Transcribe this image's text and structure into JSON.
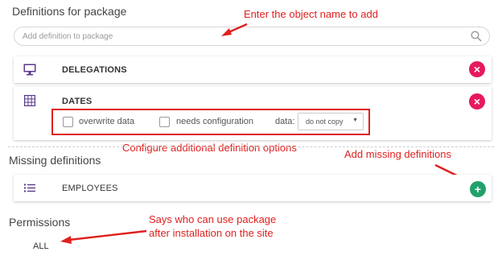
{
  "definitions": {
    "title": "Definitions for package",
    "search_placeholder": "Add definition to package",
    "items": [
      {
        "icon": "monitor-icon",
        "label": "DELEGATIONS"
      },
      {
        "icon": "grid-icon",
        "label": "DATES"
      }
    ],
    "options": {
      "overwrite_label": "overwrite data",
      "needs_config_label": "needs configuration",
      "data_label": "data:",
      "data_value": "do not copy",
      "overwrite_checked": false,
      "needs_config_checked": false
    }
  },
  "missing": {
    "title": "Missing definitions",
    "items": [
      {
        "icon": "list-icon",
        "label": "EMPLOYEES"
      }
    ]
  },
  "permissions": {
    "title": "Permissions",
    "value": "ALL"
  },
  "annotations": {
    "enter_object": "Enter the object name to add",
    "configure_options": "Configure additional definition options",
    "add_missing": "Add missing definitions",
    "permissions_line1": "Says who can use package",
    "permissions_line2": "after installation on the site"
  },
  "colors": {
    "remove": "#e6195e",
    "add": "#22a06b",
    "annotation": "#e02020",
    "icon": "#5a3a8a"
  }
}
